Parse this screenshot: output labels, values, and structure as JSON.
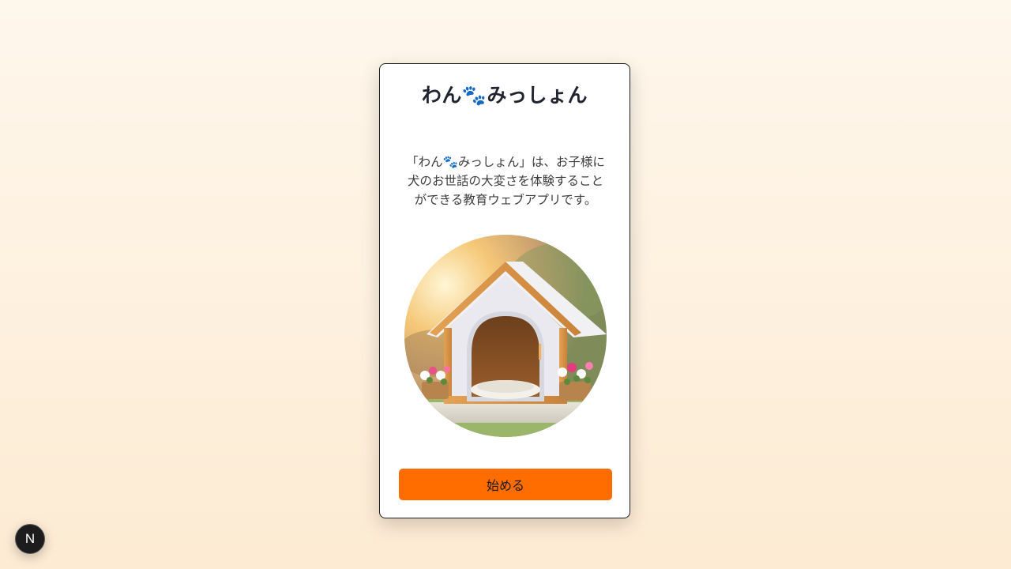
{
  "app": {
    "title": "わん🐾みっしょん",
    "description": "「わん🐾みっしょん」は、お子様に犬のお世話の大変さを体験することができる教育ウェブアプリです。",
    "start_button_label": "始める"
  },
  "hero_image": {
    "alt": "犬小屋",
    "icon": "dog-house-illustration"
  },
  "dev_badge": {
    "label": "N",
    "icon": "nextjs-logo-icon"
  },
  "colors": {
    "accent": "#ff6c00",
    "title_text": "#1f2430",
    "card_background": "#ffffff",
    "page_background_top": "#fef7ec",
    "page_background_bottom": "#fdebd3"
  }
}
